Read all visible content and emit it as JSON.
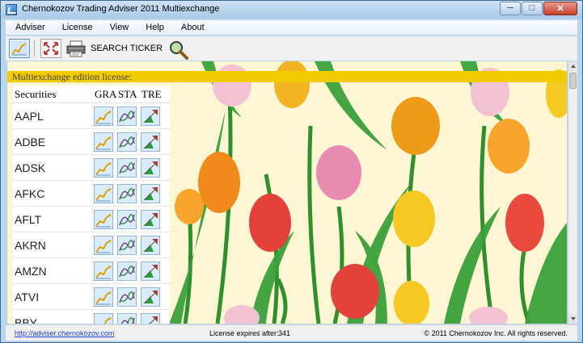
{
  "window": {
    "title": "Chernokozov Trading Adviser 2011 Multiexchange"
  },
  "window_controls": {
    "minimize": "─",
    "maximize": "□",
    "close": "✕"
  },
  "menu": [
    "Adviser",
    "License",
    "View",
    "Help",
    "About"
  ],
  "toolbar": {
    "search_label": "SEARCH TICKER",
    "icons": [
      "chart-icon",
      "fullscreen-icon",
      "printer-icon",
      "magnifier-icon"
    ]
  },
  "license_bar": "Multiexchange edition license:",
  "table": {
    "headers": {
      "securities": "Securities",
      "gra": "GRA",
      "sta": "STA",
      "tre": "TRE"
    },
    "rows": [
      "AAPL",
      "ADBE",
      "ADSK",
      "AFKC",
      "AFLT",
      "AKRN",
      "AMZN",
      "ATVI",
      "BBY"
    ]
  },
  "status": {
    "link": "http://adviser.chernokozov.com",
    "expires_label": "License expires after:",
    "expires_value": "341",
    "copyright": "© 2011 Chernokozov Inc. All rights reserved."
  },
  "colors": {
    "license_bar": "#f3cc00",
    "wallpaper": "#fdf6d3",
    "link": "#1b3fd6"
  }
}
